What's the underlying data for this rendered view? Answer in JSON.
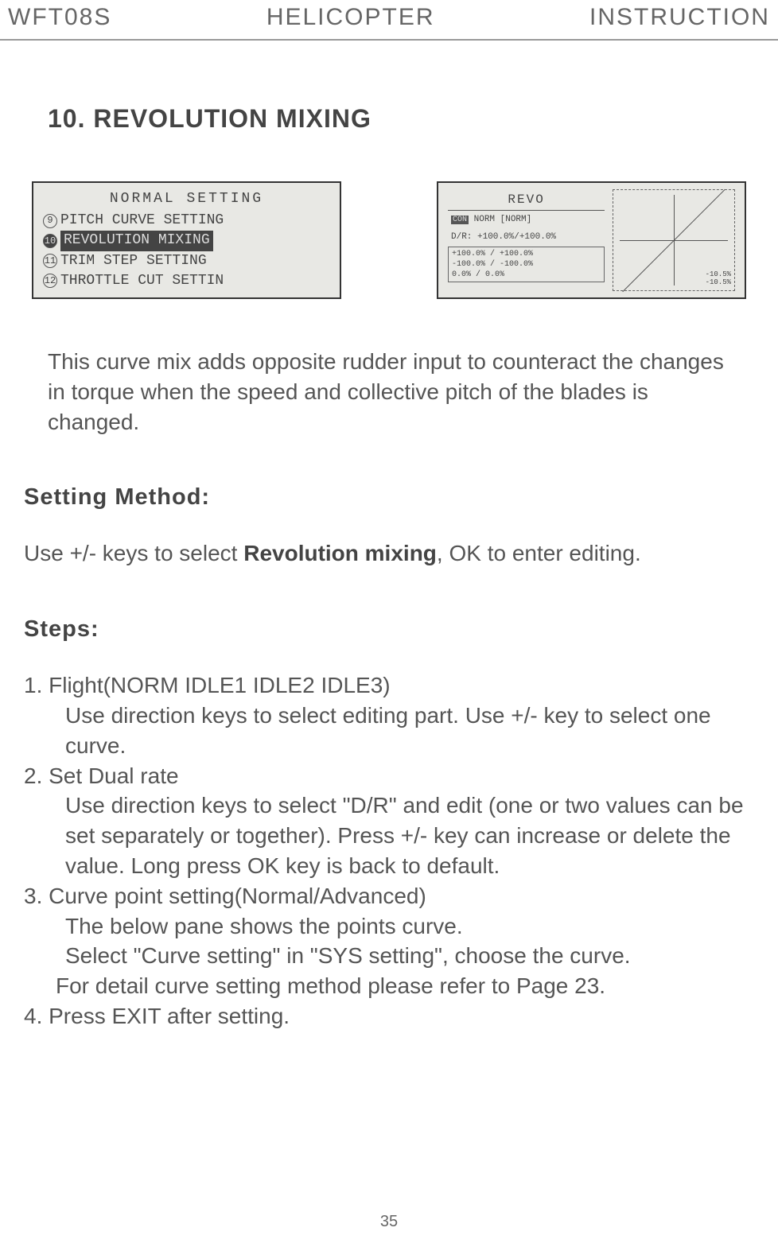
{
  "header": {
    "left": "WFT08S",
    "center": "HELICOPTER",
    "right": "INSTRUCTION"
  },
  "section_title": "10. REVOLUTION MIXING",
  "screenshot_left": {
    "header": "NORMAL SETTING",
    "items": [
      {
        "num": "9",
        "label": "PITCH CURVE SETTING",
        "selected": false
      },
      {
        "num": "10",
        "label": "REVOLUTION MIXING",
        "selected": true
      },
      {
        "num": "11",
        "label": "TRIM STEP SETTING",
        "selected": false
      },
      {
        "num": "12",
        "label": "THROTTLE CUT SETTIN",
        "selected": false
      }
    ]
  },
  "screenshot_right": {
    "title": "REVO",
    "badge": "CON",
    "mode": "NORM  [NORM]",
    "dr": "D/R: +100.0%/+100.0%",
    "values": [
      "+100.0% / +100.0%",
      "-100.0% / -100.0%",
      "0.0%    / 0.0%"
    ],
    "graph_labels": [
      "-10.5%",
      "-10.5%"
    ]
  },
  "description": "This curve mix adds opposite rudder input to counteract the changes in torque when the speed and collective pitch of the blades is changed.",
  "setting_method_title": "Setting Method:",
  "setting_method_text_pre": "Use +/- keys to select ",
  "setting_method_text_bold": "Revolution mixing",
  "setting_method_text_post": ", OK to enter editing.",
  "steps_title": "Steps:",
  "steps": {
    "s1_head": "1. Flight(NORM IDLE1 IDLE2 IDLE3)",
    "s1_body": "Use direction keys to select editing part. Use +/- key to select one curve.",
    "s2_head": "2. Set Dual rate",
    "s2_body": "Use direction keys to select \"D/R\" and edit (one or two values can be set separately or together). Press +/- key can increase or delete the value. Long press OK key is back to default.",
    "s3_head": "3. Curve point setting(Normal/Advanced)",
    "s3_body1": "The below pane shows the points curve.",
    "s3_body2": "Select \"Curve setting\" in \"SYS setting\", choose the curve.",
    "s3_body3": "For detail curve setting method please refer to Page 23.",
    "s4_head": "4. Press EXIT after setting."
  },
  "page_number": "35"
}
